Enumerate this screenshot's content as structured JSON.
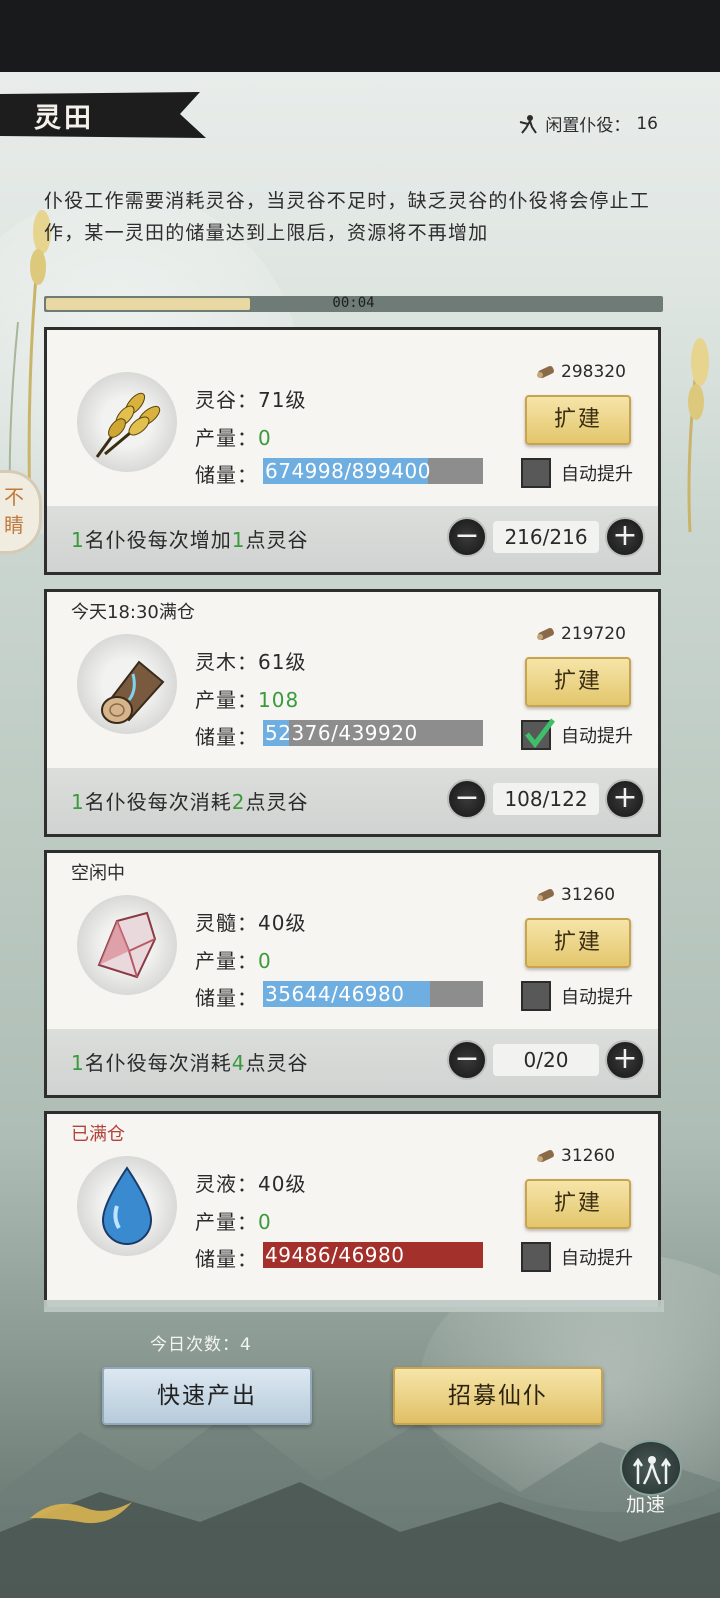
{
  "header": {
    "title": "灵田",
    "idle_label": "闲置仆役：",
    "idle_count": "16"
  },
  "description": "仆役工作需要消耗灵谷，当灵谷不足时，缺乏灵谷的仆役将会停止工作，某一灵田的储量达到上限后，资源将不再增加",
  "timer": {
    "text": "00:04",
    "progress": 0.33
  },
  "side_tab": {
    "label": "不睛"
  },
  "labels": {
    "output": "产量：",
    "storage": "储量：",
    "expand": "扩建",
    "auto_upgrade": "自动提升",
    "minus": "−",
    "plus": "+"
  },
  "fields": [
    {
      "status": "",
      "name": "灵谷：71级",
      "output": "0",
      "storage_text": "674998/899400",
      "storage_ratio": 0.75,
      "cost": "298320",
      "auto_checked": false,
      "worker_count": "1",
      "worker_mid": "名仆役每次增加",
      "worker_amount": "1",
      "worker_tail": "点灵谷",
      "stepper_value": "216/216",
      "icon": "wheat-icon"
    },
    {
      "status": "今天18:30满仓",
      "name": "灵木：61级",
      "output": "108",
      "storage_text": "52376/439920",
      "storage_ratio": 0.12,
      "cost": "219720",
      "auto_checked": true,
      "worker_count": "1",
      "worker_mid": "名仆役每次消耗",
      "worker_amount": "2",
      "worker_tail": "点灵谷",
      "stepper_value": "108/122",
      "icon": "wood-log-icon"
    },
    {
      "status": "空闲中",
      "name": "灵髓：40级",
      "output": "0",
      "storage_text": "35644/46980",
      "storage_ratio": 0.76,
      "cost": "31260",
      "auto_checked": false,
      "worker_count": "1",
      "worker_mid": "名仆役每次消耗",
      "worker_amount": "4",
      "worker_tail": "点灵谷",
      "stepper_value": "0/20",
      "icon": "crystal-icon"
    },
    {
      "status": "已满仓",
      "name": "灵液：40级",
      "output": "0",
      "storage_text": "49486/46980",
      "storage_ratio": 1.0,
      "cost": "31260",
      "auto_checked": false,
      "icon": "water-drop-icon"
    }
  ],
  "footer": {
    "daily_label": "今日次数：",
    "daily_count": "4",
    "quick_output": "快速产出",
    "recruit": "招募仙仆",
    "speed_up": "加速"
  },
  "colors": {
    "accent_gold": "#e3c66c",
    "progress_blue": "#6faee0",
    "over_red": "#a4302b",
    "green_text": "#3a9a3c",
    "status_red": "#b2423a"
  }
}
